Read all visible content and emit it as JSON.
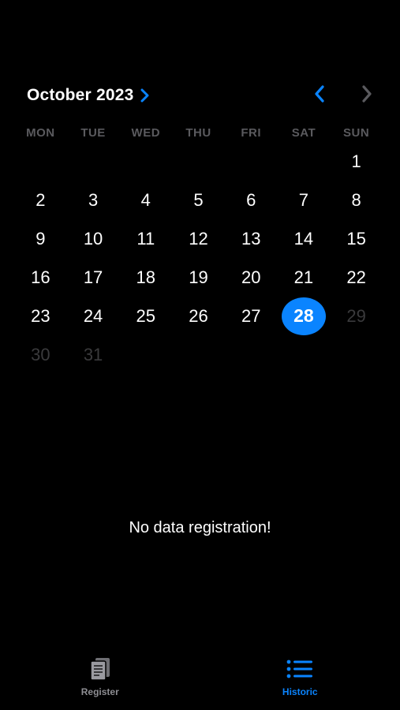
{
  "colors": {
    "accent": "#0a84ff",
    "background": "#000000",
    "text": "#ffffff",
    "muted": "#8e8e93",
    "faded_day": "#3a3a3c",
    "weekday": "#5a5a5e"
  },
  "header": {
    "month_year": "October 2023",
    "month_chevron_icon": "chevron-right-icon",
    "prev_icon": "chevron-left-icon",
    "next_icon": "chevron-right-icon"
  },
  "weekdays": [
    "MON",
    "TUE",
    "WED",
    "THU",
    "FRI",
    "SAT",
    "SUN"
  ],
  "days": [
    {
      "label": "",
      "state": "empty"
    },
    {
      "label": "",
      "state": "empty"
    },
    {
      "label": "",
      "state": "empty"
    },
    {
      "label": "",
      "state": "empty"
    },
    {
      "label": "",
      "state": "empty"
    },
    {
      "label": "",
      "state": "empty"
    },
    {
      "label": "1",
      "state": "normal"
    },
    {
      "label": "2",
      "state": "normal"
    },
    {
      "label": "3",
      "state": "normal"
    },
    {
      "label": "4",
      "state": "normal"
    },
    {
      "label": "5",
      "state": "normal"
    },
    {
      "label": "6",
      "state": "normal"
    },
    {
      "label": "7",
      "state": "normal"
    },
    {
      "label": "8",
      "state": "normal"
    },
    {
      "label": "9",
      "state": "normal"
    },
    {
      "label": "10",
      "state": "normal"
    },
    {
      "label": "11",
      "state": "normal"
    },
    {
      "label": "12",
      "state": "normal"
    },
    {
      "label": "13",
      "state": "normal"
    },
    {
      "label": "14",
      "state": "normal"
    },
    {
      "label": "15",
      "state": "normal"
    },
    {
      "label": "16",
      "state": "normal"
    },
    {
      "label": "17",
      "state": "normal"
    },
    {
      "label": "18",
      "state": "normal"
    },
    {
      "label": "19",
      "state": "normal"
    },
    {
      "label": "20",
      "state": "normal"
    },
    {
      "label": "21",
      "state": "normal"
    },
    {
      "label": "22",
      "state": "normal"
    },
    {
      "label": "23",
      "state": "normal"
    },
    {
      "label": "24",
      "state": "normal"
    },
    {
      "label": "25",
      "state": "normal"
    },
    {
      "label": "26",
      "state": "normal"
    },
    {
      "label": "27",
      "state": "normal"
    },
    {
      "label": "28",
      "state": "selected"
    },
    {
      "label": "29",
      "state": "faded"
    },
    {
      "label": "30",
      "state": "faded"
    },
    {
      "label": "31",
      "state": "faded"
    }
  ],
  "main": {
    "empty_message": "No data registration!"
  },
  "tabbar": {
    "tabs": [
      {
        "label": "Register",
        "icon": "document-icon",
        "active": false
      },
      {
        "label": "Historic",
        "icon": "list-icon",
        "active": true
      }
    ]
  }
}
